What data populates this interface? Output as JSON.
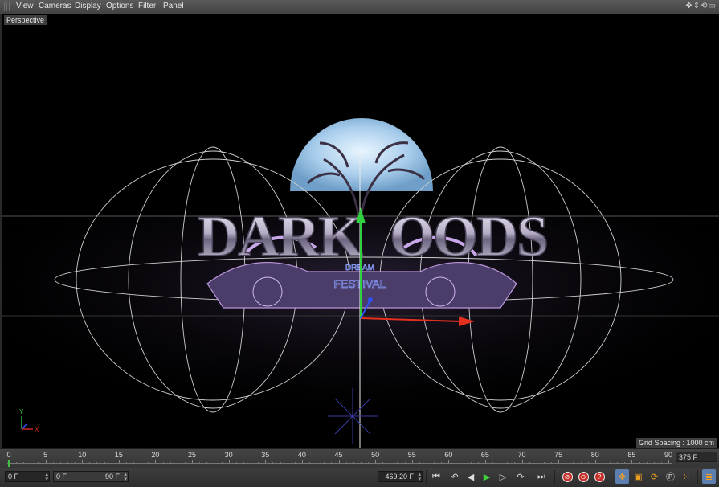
{
  "menu": {
    "items": [
      "View",
      "Cameras",
      "Display",
      "Options",
      "Filter",
      "Panel"
    ],
    "icons": [
      "move-view-icon",
      "dolly-view-icon",
      "rotate-view-icon",
      "maximize-view-icon"
    ]
  },
  "viewport": {
    "label": "Perspective",
    "grid_spacing": "Grid Spacing : 1000 cm",
    "axis_y": "Y",
    "axis_x": "X",
    "logo": {
      "word_left": "DARK",
      "word_right": "OODS",
      "sub_top": "DREAM",
      "sub_bottom": "FESTIVAL"
    },
    "colors": {
      "logo_silver": "#d8d2e4",
      "ornament": "#b996d8",
      "moon": "#b8d8f0",
      "axis_x": "#e53020",
      "axis_y": "#30d040",
      "axis_z": "#3050ff"
    }
  },
  "timeline": {
    "ticks": [
      "0",
      "5",
      "10",
      "15",
      "20",
      "25",
      "30",
      "35",
      "40",
      "45",
      "50",
      "55",
      "60",
      "65",
      "70",
      "75",
      "80",
      "85",
      "90"
    ],
    "end_frame": "375 F",
    "playhead_frame": 0
  },
  "transport": {
    "current_frame": "0 F",
    "range_start": "0 F",
    "range_end": "90 F",
    "frame_value": "469.20 F"
  }
}
